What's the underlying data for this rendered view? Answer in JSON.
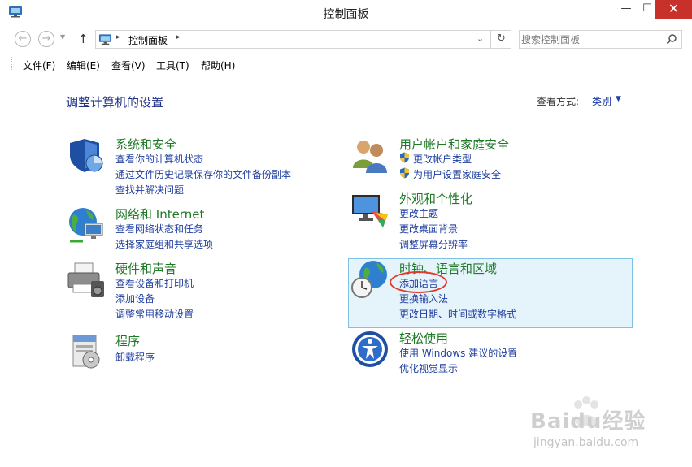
{
  "window": {
    "title": "控制面板",
    "controls": {
      "minimize": "—",
      "maximize": "☐",
      "close": "✕"
    }
  },
  "address_bar": {
    "back": "←",
    "forward": "→",
    "recent": "▼",
    "up": "↑",
    "separator": "▸",
    "crumb": "控制面板",
    "dropdown": "⌄",
    "refresh": "↻",
    "search_placeholder": "搜索控制面板"
  },
  "menu": [
    "文件(F)",
    "编辑(E)",
    "查看(V)",
    "工具(T)",
    "帮助(H)"
  ],
  "content": {
    "page_title": "调整计算机的设置",
    "view_by_label": "查看方式:",
    "view_by_value": "类别",
    "view_by_arrow": "▼"
  },
  "categories": [
    {
      "id": "system-security",
      "icon": "shield-icon",
      "title": "系统和安全",
      "links": [
        "查看你的计算机状态",
        "通过文件历史记录保存你的文件备份副本",
        "查找并解决问题"
      ]
    },
    {
      "id": "network-internet",
      "icon": "network-globe-icon",
      "title": "网络和 Internet",
      "links": [
        "查看网络状态和任务",
        "选择家庭组和共享选项"
      ]
    },
    {
      "id": "hardware-sound",
      "icon": "printer-icon",
      "title": "硬件和声音",
      "links": [
        "查看设备和打印机",
        "添加设备",
        "调整常用移动设置"
      ]
    },
    {
      "id": "programs",
      "icon": "programs-icon",
      "title": "程序",
      "links": [
        "卸载程序"
      ]
    },
    {
      "id": "user-accounts",
      "icon": "users-icon",
      "title": "用户帐户和家庭安全",
      "links": [
        "更改帐户类型",
        "为用户设置家庭安全"
      ]
    },
    {
      "id": "appearance",
      "icon": "monitor-palette-icon",
      "title": "外观和个性化",
      "links": [
        "更改主题",
        "更改桌面背景",
        "调整屏幕分辨率"
      ]
    },
    {
      "id": "clock-language-region",
      "icon": "globe-clock-icon",
      "title": "时钟、语言和区域",
      "links": [
        "添加语言",
        "更换输入法",
        "更改日期、时间或数字格式"
      ]
    },
    {
      "id": "ease-of-access",
      "icon": "accessibility-icon",
      "title": "轻松使用",
      "links": [
        "使用 Windows 建议的设置",
        "优化视觉显示"
      ]
    }
  ],
  "watermark": {
    "brand": "Baidu经验",
    "url": "jingyan.baidu.com"
  },
  "colors": {
    "category_title": "#1f7a28",
    "link": "#1f3e9f",
    "page_title": "#1e3287",
    "highlight_bg": "#e5f3fb",
    "highlight_border": "#7fc1e4",
    "annotation_ring": "#e13a2e",
    "close_button": "#c7312a"
  }
}
